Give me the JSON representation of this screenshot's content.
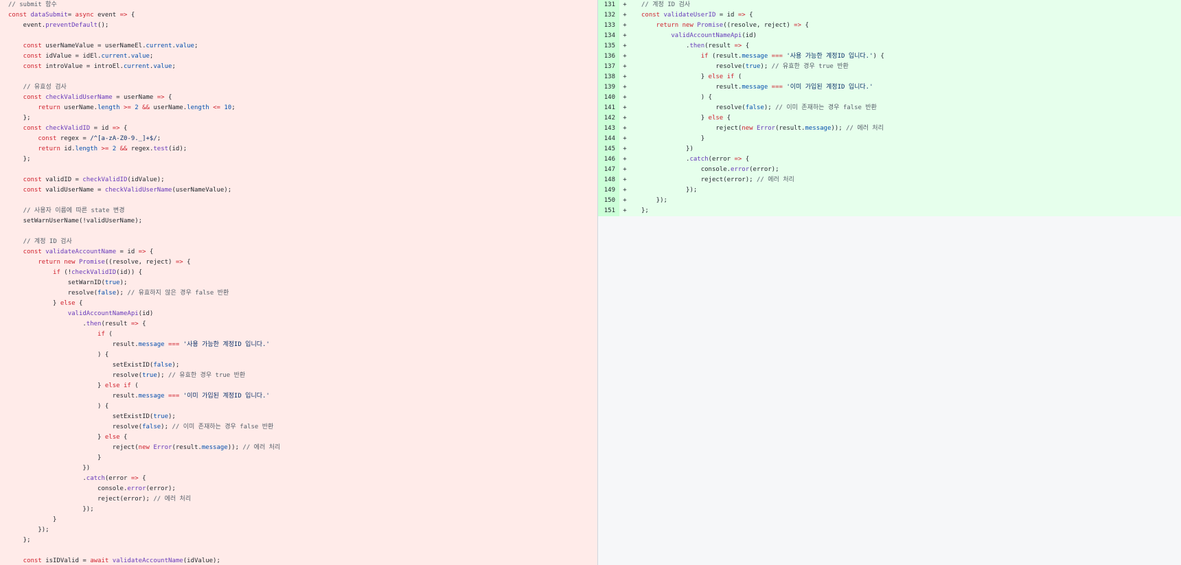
{
  "colors": {
    "deleted_bg": "#ffebe9",
    "added_bg": "#e6ffec",
    "added_gutter_bg": "#ccffd8",
    "empty_bg": "#f6f7f9",
    "keyword": "#cf222e",
    "function": "#6639ba",
    "property": "#0550ae",
    "string": "#0a3069",
    "comment": "#57606a"
  },
  "left_lines": [
    [
      [
        "c",
        "// submit 함수"
      ]
    ],
    [
      [
        "k",
        "const "
      ],
      [
        "f",
        "dataSubmit"
      ],
      [
        "",
        "= "
      ],
      [
        "k",
        "async "
      ],
      [
        "",
        "event "
      ],
      [
        "k",
        "=> "
      ],
      [
        "",
        "{"
      ]
    ],
    [
      [
        "",
        "    event."
      ],
      [
        "f",
        "preventDefault"
      ],
      [
        "",
        "();"
      ]
    ],
    [
      [
        "",
        ""
      ]
    ],
    [
      [
        "k",
        "    const "
      ],
      [
        "",
        "userNameValue = userNameEl."
      ],
      [
        "p",
        "current"
      ],
      [
        "",
        "."
      ],
      [
        "p",
        "value"
      ],
      [
        "",
        ";"
      ]
    ],
    [
      [
        "k",
        "    const "
      ],
      [
        "",
        "idValue = idEl."
      ],
      [
        "p",
        "current"
      ],
      [
        "",
        "."
      ],
      [
        "p",
        "value"
      ],
      [
        "",
        ";"
      ]
    ],
    [
      [
        "k",
        "    const "
      ],
      [
        "",
        "introValue = introEl."
      ],
      [
        "p",
        "current"
      ],
      [
        "",
        "."
      ],
      [
        "p",
        "value"
      ],
      [
        "",
        ";"
      ]
    ],
    [
      [
        "",
        ""
      ]
    ],
    [
      [
        "c",
        "    // 유효성 검사"
      ]
    ],
    [
      [
        "k",
        "    const "
      ],
      [
        "f",
        "checkValidUserName"
      ],
      [
        "",
        " = userName "
      ],
      [
        "k",
        "=> "
      ],
      [
        "",
        "{"
      ]
    ],
    [
      [
        "k",
        "        return "
      ],
      [
        "",
        "userName."
      ],
      [
        "p",
        "length"
      ],
      [
        "",
        " "
      ],
      [
        "k",
        ">= "
      ],
      [
        "p",
        "2"
      ],
      [
        "",
        " "
      ],
      [
        "k",
        "&& "
      ],
      [
        "",
        "userName."
      ],
      [
        "p",
        "length"
      ],
      [
        "",
        " "
      ],
      [
        "k",
        "<= "
      ],
      [
        "p",
        "10"
      ],
      [
        "",
        ";"
      ]
    ],
    [
      [
        "",
        "    };"
      ]
    ],
    [
      [
        "k",
        "    const "
      ],
      [
        "f",
        "checkValidID"
      ],
      [
        "",
        " = id "
      ],
      [
        "k",
        "=> "
      ],
      [
        "",
        "{"
      ]
    ],
    [
      [
        "k",
        "        const "
      ],
      [
        "",
        "regex = "
      ],
      [
        "s",
        "/^[a-zA-Z0-9._]+$/"
      ],
      [
        "",
        ";"
      ]
    ],
    [
      [
        "k",
        "        return "
      ],
      [
        "",
        "id."
      ],
      [
        "p",
        "length"
      ],
      [
        "",
        " "
      ],
      [
        "k",
        ">= "
      ],
      [
        "p",
        "2"
      ],
      [
        "",
        " "
      ],
      [
        "k",
        "&& "
      ],
      [
        "",
        "regex."
      ],
      [
        "f",
        "test"
      ],
      [
        "",
        "(id);"
      ]
    ],
    [
      [
        "",
        "    };"
      ]
    ],
    [
      [
        "",
        ""
      ]
    ],
    [
      [
        "k",
        "    const "
      ],
      [
        "",
        "validID = "
      ],
      [
        "f",
        "checkValidID"
      ],
      [
        "",
        "(idValue);"
      ]
    ],
    [
      [
        "k",
        "    const "
      ],
      [
        "",
        "validUserName = "
      ],
      [
        "f",
        "checkValidUserName"
      ],
      [
        "",
        "(userNameValue);"
      ]
    ],
    [
      [
        "",
        ""
      ]
    ],
    [
      [
        "c",
        "    // 사용자 이름에 따른 state 변경"
      ]
    ],
    [
      [
        "",
        "    setWarnUserName(!validUserName);"
      ]
    ],
    [
      [
        "",
        ""
      ]
    ],
    [
      [
        "c",
        "    // 계정 ID 검사"
      ]
    ],
    [
      [
        "k",
        "    const "
      ],
      [
        "f",
        "validateAccountName"
      ],
      [
        "",
        " = id "
      ],
      [
        "k",
        "=> "
      ],
      [
        "",
        "{"
      ]
    ],
    [
      [
        "k",
        "        return new "
      ],
      [
        "f",
        "Promise"
      ],
      [
        "",
        "((resolve, reject) "
      ],
      [
        "k",
        "=> "
      ],
      [
        "",
        "{"
      ]
    ],
    [
      [
        "k",
        "            if "
      ],
      [
        "",
        "(!"
      ],
      [
        "f",
        "checkValidID"
      ],
      [
        "",
        "(id)) {"
      ]
    ],
    [
      [
        "",
        "                setWarnID("
      ],
      [
        "p",
        "true"
      ],
      [
        "",
        ");"
      ]
    ],
    [
      [
        "",
        "                resolve("
      ],
      [
        "p",
        "false"
      ],
      [
        "",
        "); "
      ],
      [
        "c",
        "// 유효하지 않은 경우 false 반환"
      ]
    ],
    [
      [
        "",
        "            } "
      ],
      [
        "k",
        "else "
      ],
      [
        "",
        "{"
      ]
    ],
    [
      [
        "",
        "                "
      ],
      [
        "f",
        "validAccountNameApi"
      ],
      [
        "",
        "(id)"
      ]
    ],
    [
      [
        "",
        "                    ."
      ],
      [
        "f",
        "then"
      ],
      [
        "",
        "(result "
      ],
      [
        "k",
        "=> "
      ],
      [
        "",
        "{"
      ]
    ],
    [
      [
        "k",
        "                        if "
      ],
      [
        "",
        "("
      ]
    ],
    [
      [
        "",
        "                            result."
      ],
      [
        "p",
        "message"
      ],
      [
        "",
        " "
      ],
      [
        "k",
        "=== "
      ],
      [
        "s",
        "'사용 가능한 계정ID 입니다.'"
      ]
    ],
    [
      [
        "",
        "                        ) {"
      ]
    ],
    [
      [
        "",
        "                            setExistID("
      ],
      [
        "p",
        "false"
      ],
      [
        "",
        ");"
      ]
    ],
    [
      [
        "",
        "                            resolve("
      ],
      [
        "p",
        "true"
      ],
      [
        "",
        "); "
      ],
      [
        "c",
        "// 유효한 경우 true 반환"
      ]
    ],
    [
      [
        "",
        "                        } "
      ],
      [
        "k",
        "else if "
      ],
      [
        "",
        "("
      ]
    ],
    [
      [
        "",
        "                            result."
      ],
      [
        "p",
        "message"
      ],
      [
        "",
        " "
      ],
      [
        "k",
        "=== "
      ],
      [
        "s",
        "'이미 가입된 계정ID 입니다.'"
      ]
    ],
    [
      [
        "",
        "                        ) {"
      ]
    ],
    [
      [
        "",
        "                            setExistID("
      ],
      [
        "p",
        "true"
      ],
      [
        "",
        ");"
      ]
    ],
    [
      [
        "",
        "                            resolve("
      ],
      [
        "p",
        "false"
      ],
      [
        "",
        "); "
      ],
      [
        "c",
        "// 이미 존재하는 경우 false 반환"
      ]
    ],
    [
      [
        "",
        "                        } "
      ],
      [
        "k",
        "else "
      ],
      [
        "",
        "{"
      ]
    ],
    [
      [
        "",
        "                            reject("
      ],
      [
        "k",
        "new "
      ],
      [
        "f",
        "Error"
      ],
      [
        "",
        "(result."
      ],
      [
        "p",
        "message"
      ],
      [
        "",
        "));"
      ],
      [
        "",
        " "
      ],
      [
        "c",
        "// 에러 처리"
      ]
    ],
    [
      [
        "",
        "                        }"
      ]
    ],
    [
      [
        "",
        "                    })"
      ]
    ],
    [
      [
        "",
        "                    ."
      ],
      [
        "f",
        "catch"
      ],
      [
        "",
        "(error "
      ],
      [
        "k",
        "=> "
      ],
      [
        "",
        "{"
      ]
    ],
    [
      [
        "",
        "                        console."
      ],
      [
        "f",
        "error"
      ],
      [
        "",
        "(error);"
      ]
    ],
    [
      [
        "",
        "                        reject(error); "
      ],
      [
        "c",
        "// 에러 처리"
      ]
    ],
    [
      [
        "",
        "                    });"
      ]
    ],
    [
      [
        "",
        "            }"
      ]
    ],
    [
      [
        "",
        "        });"
      ]
    ],
    [
      [
        "",
        "    };"
      ]
    ],
    [
      [
        "",
        ""
      ]
    ],
    [
      [
        "k",
        "    const "
      ],
      [
        "",
        "isIDValid = "
      ],
      [
        "k",
        "await "
      ],
      [
        "f",
        "validateAccountName"
      ],
      [
        "",
        "(idValue);"
      ]
    ]
  ],
  "right_lines": [
    {
      "num": "131",
      "marker": "+",
      "tokens": [
        [
          "c",
          "// 계정 ID 검사"
        ]
      ]
    },
    {
      "num": "132",
      "marker": "+",
      "tokens": [
        [
          "k",
          "const "
        ],
        [
          "f",
          "validateUserID"
        ],
        [
          "",
          " = id "
        ],
        [
          "k",
          "=> "
        ],
        [
          "",
          "{"
        ]
      ]
    },
    {
      "num": "133",
      "marker": "+",
      "tokens": [
        [
          "k",
          "    return new "
        ],
        [
          "f",
          "Promise"
        ],
        [
          "",
          "((resolve, reject) "
        ],
        [
          "k",
          "=> "
        ],
        [
          "",
          "{"
        ]
      ]
    },
    {
      "num": "134",
      "marker": "+",
      "tokens": [
        [
          "",
          "        "
        ],
        [
          "f",
          "validAccountNameApi"
        ],
        [
          "",
          "(id)"
        ]
      ]
    },
    {
      "num": "135",
      "marker": "+",
      "tokens": [
        [
          "",
          "            ."
        ],
        [
          "f",
          "then"
        ],
        [
          "",
          "(result "
        ],
        [
          "k",
          "=> "
        ],
        [
          "",
          "{"
        ]
      ]
    },
    {
      "num": "136",
      "marker": "+",
      "tokens": [
        [
          "k",
          "                if "
        ],
        [
          "",
          "(result."
        ],
        [
          "p",
          "message"
        ],
        [
          "",
          " "
        ],
        [
          "k",
          "=== "
        ],
        [
          "s",
          "'사용 가능한 계정ID 입니다.'"
        ],
        [
          "",
          ") {"
        ]
      ]
    },
    {
      "num": "137",
      "marker": "+",
      "tokens": [
        [
          "",
          "                    resolve("
        ],
        [
          "p",
          "true"
        ],
        [
          "",
          "); "
        ],
        [
          "c",
          "// 유효한 경우 true 반환"
        ]
      ]
    },
    {
      "num": "138",
      "marker": "+",
      "tokens": [
        [
          "",
          "                } "
        ],
        [
          "k",
          "else if "
        ],
        [
          "",
          "("
        ]
      ]
    },
    {
      "num": "139",
      "marker": "+",
      "tokens": [
        [
          "",
          "                    result."
        ],
        [
          "p",
          "message"
        ],
        [
          "",
          " "
        ],
        [
          "k",
          "=== "
        ],
        [
          "s",
          "'이미 가입된 계정ID 입니다.'"
        ]
      ]
    },
    {
      "num": "140",
      "marker": "+",
      "tokens": [
        [
          "",
          "                ) {"
        ]
      ]
    },
    {
      "num": "141",
      "marker": "+",
      "tokens": [
        [
          "",
          "                    resolve("
        ],
        [
          "p",
          "false"
        ],
        [
          "",
          "); "
        ],
        [
          "c",
          "// 이미 존재하는 경우 false 반환"
        ]
      ]
    },
    {
      "num": "142",
      "marker": "+",
      "tokens": [
        [
          "",
          "                } "
        ],
        [
          "k",
          "else "
        ],
        [
          "",
          "{"
        ]
      ]
    },
    {
      "num": "143",
      "marker": "+",
      "tokens": [
        [
          "",
          "                    reject("
        ],
        [
          "k",
          "new "
        ],
        [
          "f",
          "Error"
        ],
        [
          "",
          "(result."
        ],
        [
          "p",
          "message"
        ],
        [
          "",
          "));"
        ],
        [
          "",
          " "
        ],
        [
          "c",
          "// 에러 처리"
        ]
      ]
    },
    {
      "num": "144",
      "marker": "+",
      "tokens": [
        [
          "",
          "                }"
        ]
      ]
    },
    {
      "num": "145",
      "marker": "+",
      "tokens": [
        [
          "",
          "            })"
        ]
      ]
    },
    {
      "num": "146",
      "marker": "+",
      "tokens": [
        [
          "",
          "            ."
        ],
        [
          "f",
          "catch"
        ],
        [
          "",
          "(error "
        ],
        [
          "k",
          "=> "
        ],
        [
          "",
          "{"
        ]
      ]
    },
    {
      "num": "147",
      "marker": "+",
      "tokens": [
        [
          "",
          "                console."
        ],
        [
          "f",
          "error"
        ],
        [
          "",
          "(error);"
        ]
      ]
    },
    {
      "num": "148",
      "marker": "+",
      "tokens": [
        [
          "",
          "                reject(error); "
        ],
        [
          "c",
          "// 에러 처리"
        ]
      ]
    },
    {
      "num": "149",
      "marker": "+",
      "tokens": [
        [
          "",
          "            });"
        ]
      ]
    },
    {
      "num": "150",
      "marker": "+",
      "tokens": [
        [
          "",
          "    });"
        ]
      ]
    },
    {
      "num": "151",
      "marker": "+",
      "tokens": [
        [
          "",
          "};"
        ]
      ]
    }
  ]
}
